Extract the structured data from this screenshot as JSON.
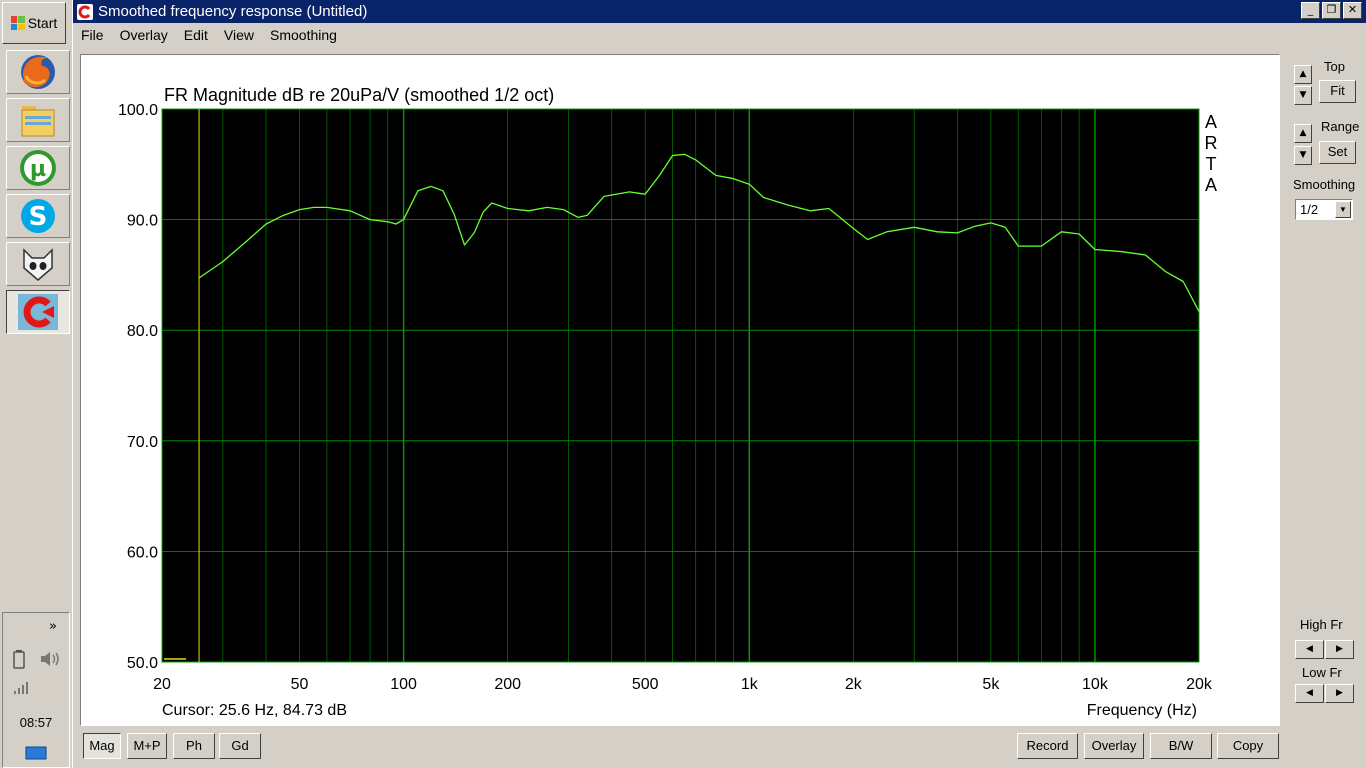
{
  "taskbar": {
    "start_label": "Start",
    "apps": [
      {
        "name": "firefox-icon"
      },
      {
        "name": "folder-icon"
      },
      {
        "name": "utorrent-icon"
      },
      {
        "name": "skype-icon"
      },
      {
        "name": "foobar-icon"
      },
      {
        "name": "arta-icon"
      }
    ],
    "tray_chevron": "»",
    "clock": "08:57"
  },
  "window": {
    "title": "Smoothed frequency response (Untitled)",
    "menu": [
      "File",
      "Overlay",
      "Edit",
      "View",
      "Smoothing"
    ],
    "minimize_glyph": "_",
    "restore_glyph": "❐",
    "close_glyph": "✕"
  },
  "right_panel": {
    "top_label": "Top",
    "fit_label": "Fit",
    "range_label": "Range",
    "set_label": "Set",
    "smoothing_label": "Smoothing",
    "smoothing_value": "1/2",
    "high_fr_label": "High Fr",
    "low_fr_label": "Low Fr",
    "up_glyph": "▲",
    "down_glyph": "▼",
    "left_glyph": "◀",
    "right_glyph": "▶"
  },
  "bottom_buttons": {
    "mag": "Mag",
    "mp": "M+P",
    "ph": "Ph",
    "gd": "Gd",
    "record": "Record",
    "overlay": "Overlay",
    "bw": "B/W",
    "copy": "Copy"
  },
  "colors": {
    "plot_bg": "#000000",
    "grid": "#00a000",
    "curve": "#66ff33",
    "cursor": "#e0e000"
  },
  "chart_data": {
    "type": "line",
    "title": "FR Magnitude dB re 20uPa/V (smoothed 1/2 oct)",
    "xlabel": "Frequency (Hz)",
    "ylabel": "",
    "x_scale": "log",
    "xlim": [
      20,
      20000
    ],
    "ylim": [
      50,
      100
    ],
    "y_ticks": [
      "100.0",
      "90.0",
      "80.0",
      "70.0",
      "60.0",
      "50.0"
    ],
    "y_tick_values": [
      100,
      90,
      80,
      70,
      60,
      50
    ],
    "x_ticks": [
      "20",
      "50",
      "100",
      "200",
      "500",
      "1k",
      "2k",
      "5k",
      "10k",
      "20k"
    ],
    "x_tick_values": [
      20,
      50,
      100,
      200,
      500,
      1000,
      2000,
      5000,
      10000,
      20000
    ],
    "grid": true,
    "watermark": [
      "A",
      "R",
      "T",
      "A"
    ],
    "cursor_text": "Cursor: 25.6 Hz, 84.73 dB",
    "cursor_freq": 25.6,
    "series": [
      {
        "x": [
          25.6,
          30,
          35,
          40,
          45,
          50,
          55,
          60,
          70,
          80,
          90,
          95,
          100,
          110,
          120,
          130,
          140,
          150,
          160,
          170,
          180,
          200,
          230,
          260,
          290,
          320,
          340,
          380,
          450,
          500,
          550,
          600,
          650,
          700,
          800,
          900,
          1000,
          1100,
          1300,
          1500,
          1700,
          2000,
          2200,
          2500,
          3000,
          3500,
          4000,
          4500,
          5000,
          5500,
          6000,
          7000,
          8000,
          9000,
          10000,
          12000,
          14000,
          16000,
          18000,
          20000
        ],
        "y": [
          84.73,
          86.2,
          88.0,
          89.6,
          90.4,
          90.9,
          91.1,
          91.1,
          90.8,
          90.0,
          89.8,
          89.6,
          90.0,
          92.6,
          93.0,
          92.6,
          90.5,
          87.7,
          88.8,
          90.7,
          91.5,
          91.0,
          90.8,
          91.1,
          90.9,
          90.2,
          90.4,
          92.1,
          92.5,
          92.3,
          94.0,
          95.8,
          95.9,
          95.4,
          94.0,
          93.7,
          93.2,
          92.0,
          91.3,
          90.8,
          91.0,
          89.2,
          88.2,
          88.9,
          89.3,
          88.9,
          88.8,
          89.4,
          89.7,
          89.3,
          87.6,
          87.6,
          88.9,
          88.7,
          87.3,
          87.1,
          86.8,
          85.3,
          84.4,
          81.7
        ]
      }
    ]
  }
}
